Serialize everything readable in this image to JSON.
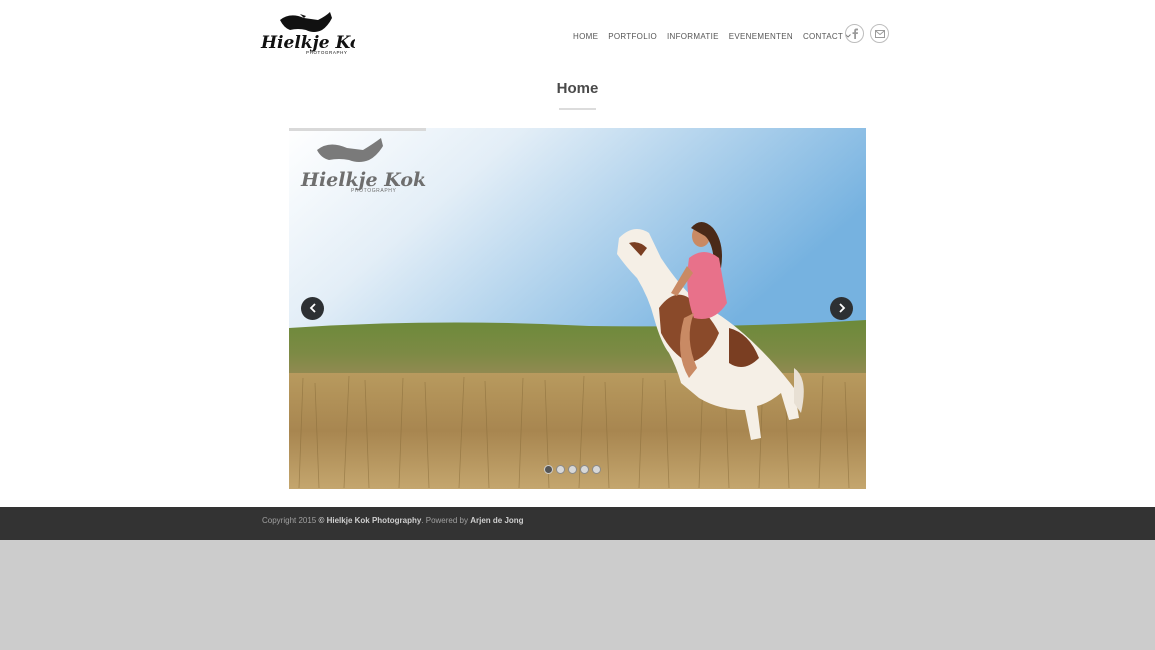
{
  "header": {
    "logo_text": "Hielkje Kok",
    "logo_subtext": "PHOTOGRAPHY",
    "nav": [
      {
        "label": "HOME"
      },
      {
        "label": "PORTFOLIO"
      },
      {
        "label": "INFORMATIE"
      },
      {
        "label": "EVENEMENTEN"
      },
      {
        "label": "CONTACT"
      }
    ],
    "social": [
      {
        "icon": "facebook-icon"
      },
      {
        "icon": "mail-icon"
      }
    ]
  },
  "main": {
    "title": "Home"
  },
  "slider": {
    "watermark_text": "Hielkje Kok",
    "watermark_subtext": "PHOTOGRAPHY",
    "prev_icon": "chevron-left-icon",
    "next_icon": "chevron-right-icon",
    "slide_count": 5,
    "active_slide": 1
  },
  "footer": {
    "prefix": "Copyright 2015 ",
    "company": "© Hielkje Kok Photography",
    "middle": ". Powered by ",
    "author": "Arjen de Jong"
  },
  "colors": {
    "footer_bg": "#333333",
    "page_bg": "#cccccc",
    "title": "#4a4a4a"
  }
}
